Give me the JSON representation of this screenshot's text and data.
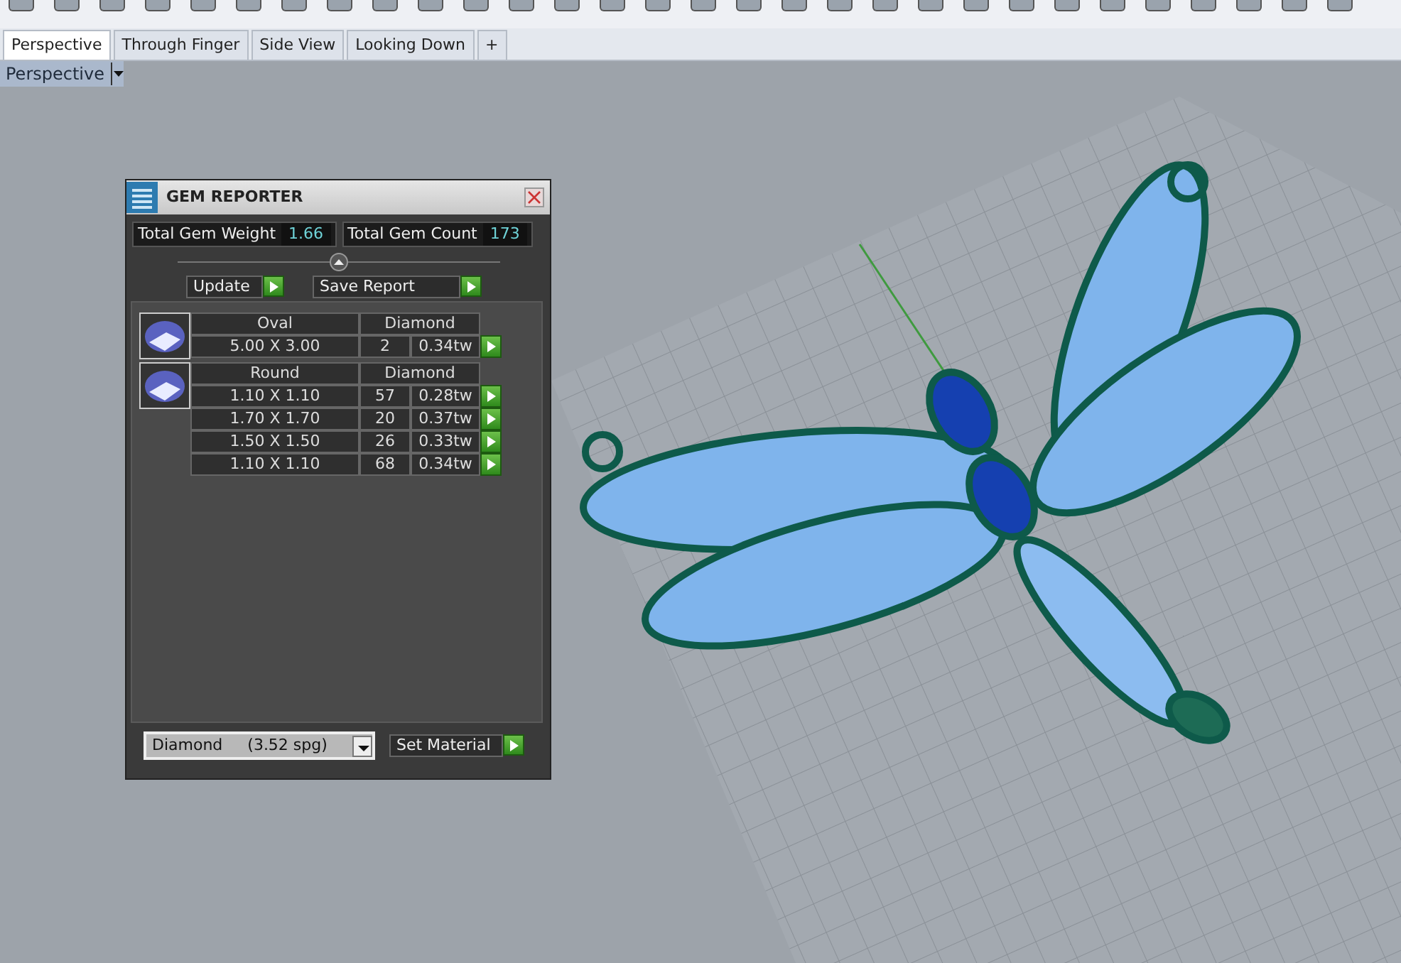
{
  "tabs": [
    {
      "label": "Perspective",
      "selected": true
    },
    {
      "label": "Through Finger",
      "selected": false
    },
    {
      "label": "Side View",
      "selected": false
    },
    {
      "label": "Looking Down",
      "selected": false
    }
  ],
  "new_tab": "+",
  "viewport": {
    "label": "Perspective"
  },
  "gem_reporter": {
    "title": "GEM REPORTER",
    "totals": [
      {
        "label": "Total Gem Weight",
        "value": "1.66"
      },
      {
        "label": "Total Gem Count",
        "value": "173"
      }
    ],
    "buttons": [
      "Update",
      "Save Report"
    ],
    "groups": [
      {
        "shape": "Oval",
        "material": "Diamond",
        "rows": [
          {
            "size": "5.00 X 3.00",
            "count": "2",
            "weight": "0.34tw"
          }
        ]
      },
      {
        "shape": "Round",
        "material": "Diamond",
        "rows": [
          {
            "size": "1.10 X 1.10",
            "count": "57",
            "weight": "0.28tw"
          },
          {
            "size": "1.70 X 1.70",
            "count": "20",
            "weight": "0.37tw"
          },
          {
            "size": "1.50 X 1.50",
            "count": "26",
            "weight": "0.33tw"
          },
          {
            "size": "1.10 X 1.10",
            "count": "68",
            "weight": "0.34tw"
          }
        ]
      }
    ],
    "material_select": "Diamond     (3.52 spg)",
    "set_material": "Set Material"
  }
}
